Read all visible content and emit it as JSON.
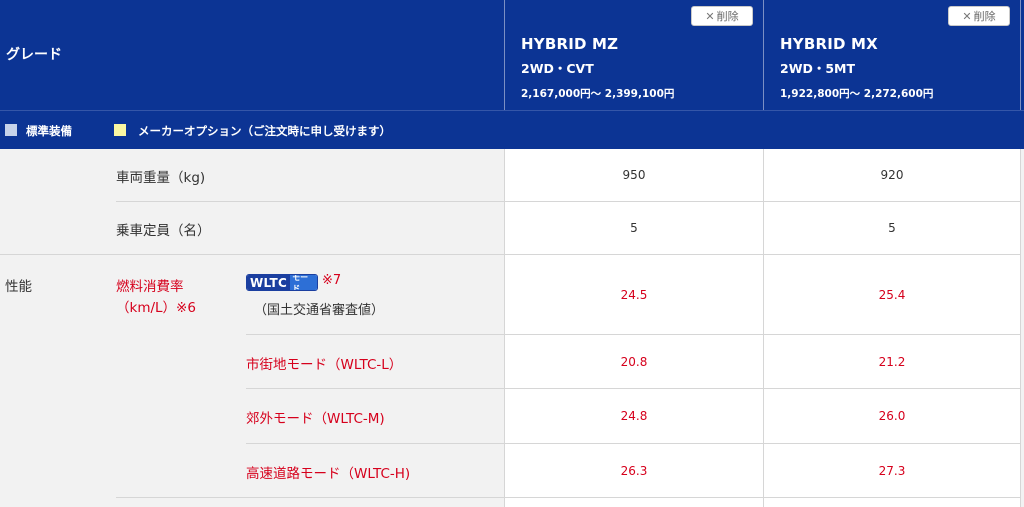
{
  "header": {
    "grade_label": "グレード",
    "models": [
      {
        "delete_label": "削除",
        "name": "HYBRID MZ",
        "drive": "2WD・CVT",
        "price": "2,167,000円～ 2,399,100円"
      },
      {
        "delete_label": "削除",
        "name": "HYBRID MX",
        "drive": "2WD・5MT",
        "price": "1,922,800円～ 2,272,600円"
      }
    ]
  },
  "legend": {
    "standard": "標準装備",
    "option": "メーカーオプション（ご注文時に申し受けます）",
    "colors": {
      "standard": "#c7d3ea",
      "option": "#fbf7a2",
      "header_bg": "#0c3494",
      "accent_red": "#d6001c"
    }
  },
  "spec": {
    "weight": {
      "label": "車両重量（kg)",
      "values": [
        "950",
        "920"
      ]
    },
    "capacity": {
      "label": "乗車定員（名）",
      "values": [
        "5",
        "5"
      ]
    },
    "performance": {
      "section_label": "性能",
      "fuel_label_line1": "燃料消費率",
      "fuel_label_line2": "（km/L）※6",
      "wltc_logo_text": "WLTC",
      "wltc_logo_sub": "モード",
      "wltc_note": "※7",
      "wltc_sub": "（国土交通省審査値）",
      "wltc_values": [
        "24.5",
        "25.4"
      ],
      "city": {
        "label": "市街地モード（WLTC-L）",
        "values": [
          "20.8",
          "21.2"
        ]
      },
      "suburban": {
        "label": "郊外モード（WLTC-M)",
        "values": [
          "24.8",
          "26.0"
        ]
      },
      "highway": {
        "label": "高速道路モード（WLTC-H)",
        "values": [
          "26.3",
          "27.3"
        ]
      }
    }
  },
  "icons": {
    "delete": "close-icon"
  }
}
